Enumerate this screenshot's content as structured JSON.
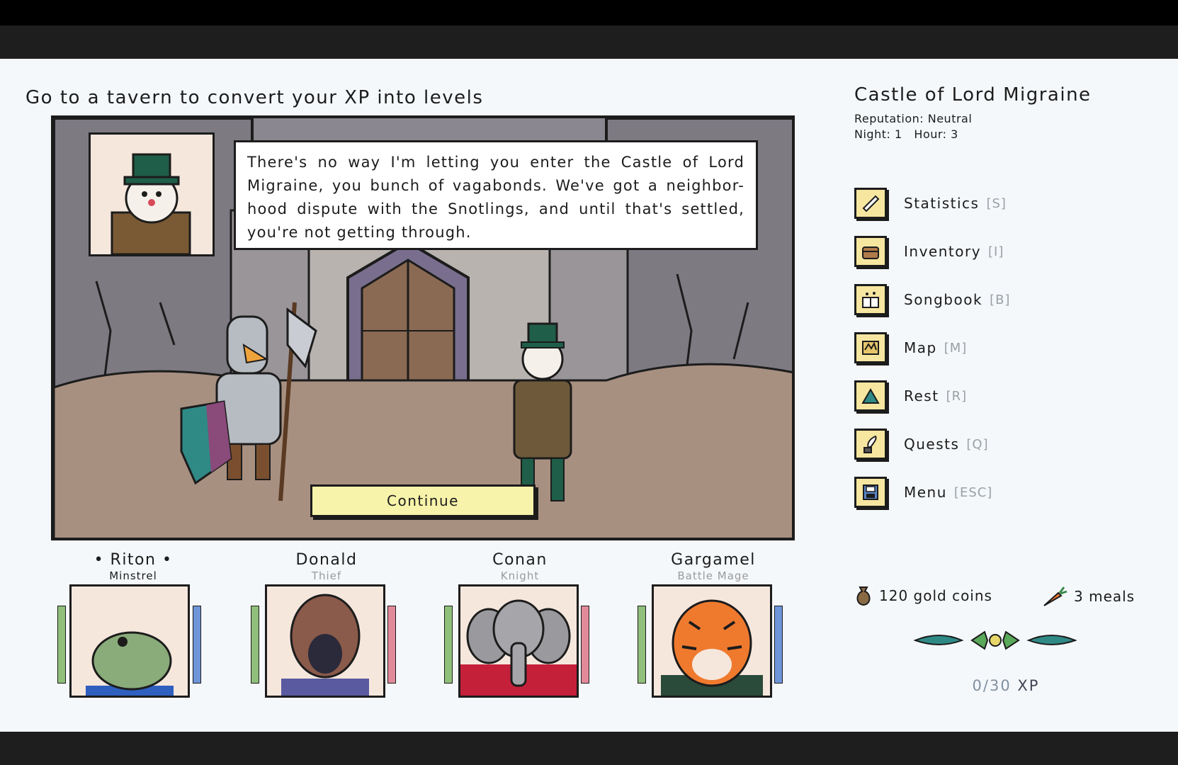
{
  "hint": "Go to a tavern to convert your XP into levels",
  "dialogue": {
    "text": "There's no way I'm letting you enter the Castle of Lord Migraine, you bunch of vagabonds. We've got a neighbor-hood dispute with the Snotlings, and until that's settled, you're not getting through.",
    "continue_label": "Continue"
  },
  "location": {
    "title": "Castle of Lord Migraine",
    "reputation": "Reputation: Neutral",
    "night": "Night: 1",
    "hour": "Hour: 3"
  },
  "menu": [
    {
      "label": "Statistics",
      "key": "[S]",
      "icon": "scroll-icon"
    },
    {
      "label": "Inventory",
      "key": "[I]",
      "icon": "chest-icon"
    },
    {
      "label": "Songbook",
      "key": "[B]",
      "icon": "songbook-icon"
    },
    {
      "label": "Map",
      "key": "[M]",
      "icon": "map-icon"
    },
    {
      "label": "Rest",
      "key": "[R]",
      "icon": "tent-icon"
    },
    {
      "label": "Quests",
      "key": "[Q]",
      "icon": "quill-icon"
    },
    {
      "label": "Menu",
      "key": "[ESC]",
      "icon": "floppy-icon"
    }
  ],
  "resources": {
    "gold": "120 gold coins",
    "meals": "3 meals"
  },
  "xp": {
    "current": "0/30",
    "unit": "XP",
    "progress": 0
  },
  "party": [
    {
      "name": "• Riton •",
      "class": "Minstrel",
      "active": true,
      "portrait": "frog-portrait",
      "left_bar": "#8fbf7a",
      "right_bar": "#6d95d8"
    },
    {
      "name": "Donald",
      "class": "Thief",
      "active": false,
      "portrait": "hedgehog-portrait",
      "left_bar": "#8fbf7a",
      "right_bar": "#e28a9a"
    },
    {
      "name": "Conan",
      "class": "Knight",
      "active": false,
      "portrait": "elephant-portrait",
      "left_bar": "#8fbf7a",
      "right_bar": "#e28a9a"
    },
    {
      "name": "Gargamel",
      "class": "Battle Mage",
      "active": false,
      "portrait": "tiger-portrait",
      "left_bar": "#8fbf7a",
      "right_bar": "#6d95d8"
    }
  ]
}
